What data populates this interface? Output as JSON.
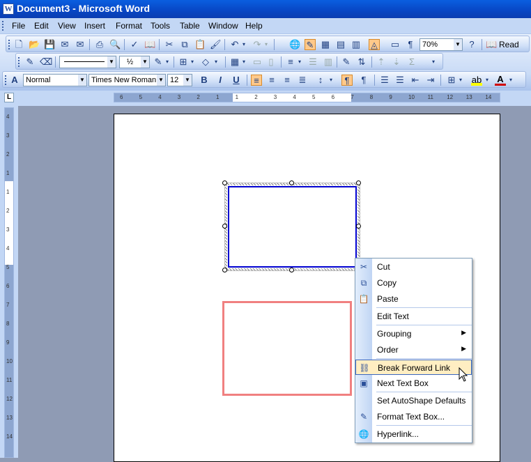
{
  "window": {
    "title": "Document3 - Microsoft Word"
  },
  "menubar": {
    "items": [
      "File",
      "Edit",
      "View",
      "Insert",
      "Format",
      "Tools",
      "Table",
      "Window",
      "Help"
    ]
  },
  "standard_toolbar": {
    "zoom": "70%",
    "read_label": "Read"
  },
  "drawing_toolbar": {
    "line_weight": "½"
  },
  "formatting_toolbar": {
    "style": "Normal",
    "font": "Times New Roman",
    "size": "12"
  },
  "rulers": {
    "horizontal_ticks": [
      "6",
      "5",
      "4",
      "3",
      "2",
      "1",
      "1",
      "2",
      "3",
      "4",
      "5",
      "6",
      "7",
      "8",
      "9",
      "10",
      "11",
      "12",
      "13",
      "14"
    ],
    "vertical_ticks": [
      "4",
      "3",
      "2",
      "1",
      "1",
      "2",
      "3",
      "4",
      "5",
      "6",
      "7",
      "8",
      "9",
      "10",
      "11",
      "12",
      "13",
      "14"
    ]
  },
  "context_menu": {
    "items": [
      {
        "label": "Cut",
        "icon": "scissors-icon"
      },
      {
        "label": "Copy",
        "icon": "copy-icon"
      },
      {
        "label": "Paste",
        "icon": "paste-icon"
      },
      {
        "label": "Edit Text",
        "icon": ""
      },
      {
        "label": "Grouping",
        "icon": "",
        "submenu": true
      },
      {
        "label": "Order",
        "icon": "",
        "submenu": true
      },
      {
        "label": "Break Forward Link",
        "icon": "break-link-icon",
        "highlighted": true
      },
      {
        "label": "Next Text Box",
        "icon": "next-textbox-icon"
      },
      {
        "label": "Set AutoShape Defaults",
        "icon": ""
      },
      {
        "label": "Format Text Box...",
        "icon": "format-icon"
      },
      {
        "label": "Hyperlink...",
        "icon": "hyperlink-icon"
      }
    ]
  },
  "colors": {
    "titlebar": "#0a5fe0",
    "selected_box_border": "#0000d0",
    "second_box_border": "#f08080",
    "menu_highlight": "#ffeec2"
  }
}
